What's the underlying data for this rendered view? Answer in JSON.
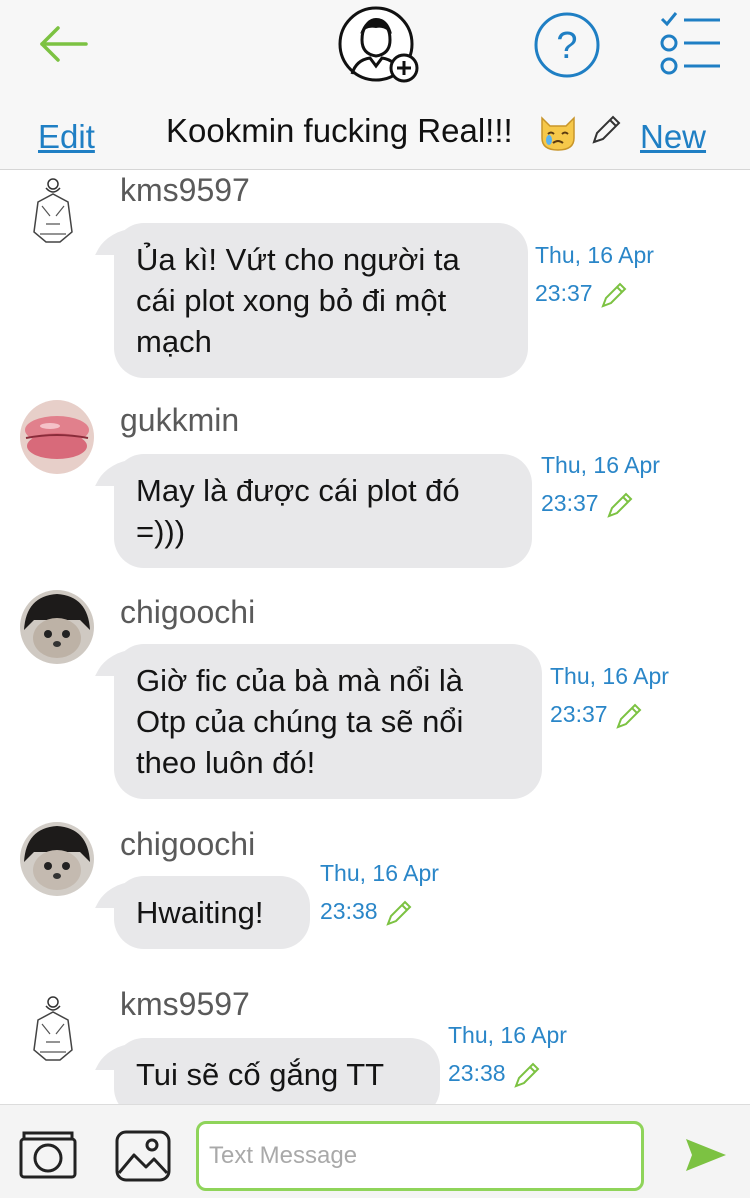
{
  "header": {
    "edit_label": "Edit",
    "title": "Kookmin fucking Real!!!",
    "new_label": "New"
  },
  "messages": [
    {
      "user": "kms9597",
      "text": "Ủa kì! Vứt cho người ta cái plot xong bỏ đi một mạch",
      "date": "Thu, 16 Apr",
      "time": "23:37"
    },
    {
      "user": "gukkmin",
      "text": "May là được cái plot đó =)))",
      "date": "Thu, 16 Apr",
      "time": "23:37"
    },
    {
      "user": "chigoochi",
      "text": "Giờ fic của bà mà nổi là Otp của chúng ta sẽ nổi theo luôn đó!",
      "date": "Thu, 16 Apr",
      "time": "23:37"
    },
    {
      "user": "chigoochi",
      "text": "Hwaiting!",
      "date": "Thu, 16 Apr",
      "time": "23:38"
    },
    {
      "user": "kms9597",
      "text": "Tui sẽ cố gắng TT",
      "date": "Thu, 16 Apr",
      "time": "23:38"
    }
  ],
  "composer": {
    "placeholder": "Text Message"
  },
  "colors": {
    "accent_blue": "#1f7fc4",
    "accent_green": "#7cc242",
    "bubble_gray": "#e8e8ea"
  },
  "icons": [
    "back-arrow-icon",
    "add-contact-icon",
    "help-icon",
    "checklist-icon",
    "crying-cat-emoji-icon",
    "pencil-icon",
    "camera-icon",
    "gallery-icon",
    "send-icon"
  ]
}
